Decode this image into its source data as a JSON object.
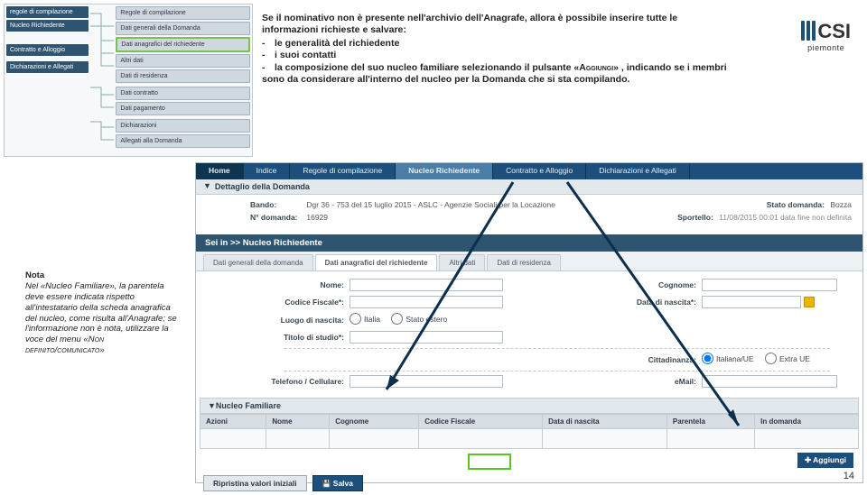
{
  "miniLeft": [
    "regole di compilazione",
    "Nucleo Richiedente",
    "",
    "",
    "Contratto e Alloggio",
    "",
    "Dichiarazioni e Allegati"
  ],
  "miniRight": [
    "Regole di compilazione",
    "Dati generali della Domanda",
    "Dati anagrafici del richiedente",
    "Altri dati",
    "Dati di residenza",
    "",
    "Dati contratto",
    "Dati pagamento",
    "",
    "Dichiarazioni",
    "Allegati alla Domanda"
  ],
  "intro": {
    "p1": "Se il nominativo non è presente nell'archivio dell'Anagrafe, allora è possibile inserire tutte le informazioni richieste e salvare:",
    "li1": "le generalità del richiedente",
    "li2": "i suoi contatti",
    "li3a": "la composizione del suo nucleo familiare selezionando il pulsante «",
    "li3btn": "Aggiungi",
    "li3b": "» , indicando se i membri sono da considerare all'interno del nucleo per la Domanda che si sta compilando."
  },
  "logo": {
    "brand": "CSI",
    "sub": "piemonte"
  },
  "note": {
    "title": "Nota",
    "body1": "Nel «Nucleo Familiare», la parentela deve essere indicata rispetto all'intestatario della scheda anagrafica del nucleo, come risulta all'Anagrafe; se l'informazione non è nota, utilizzare la voce del menu «",
    "sc": "Non definito/comunicato",
    "body2": "»"
  },
  "topbar": {
    "home": "Home",
    "t1": "Indice",
    "t2": "Regole di compilazione",
    "t3": "Nucleo Richiedente",
    "t4": "Contratto e Alloggio",
    "t5": "Dichiarazioni e Allegati"
  },
  "dettaglio": {
    "title": "Dettaglio della Domanda",
    "bandoL": "Bando:",
    "bandoV": "Dgr 36 - 753 del 15 luglio 2015 - ASLC - Agenzie Sociali per la Locazione",
    "numL": "N° domanda:",
    "numV": "16929",
    "statoL": "Stato domanda:",
    "statoV": "Bozza",
    "sportL": "Sportello:",
    "sportV": "11/08/2015 00:01   data fine non definita"
  },
  "crumb": "Sei in >> Nucleo Richiedente",
  "subtabs": {
    "t1": "Dati generali della domanda",
    "t2": "Dati anagrafici del richiedente",
    "t3": "Altri dati",
    "t4": "Dati di residenza"
  },
  "form": {
    "nome": "Nome:",
    "cognome": "Cognome:",
    "cf": "Codice Fiscale*:",
    "dn": "Data di nascita*:",
    "ln": "Luogo di nascita:",
    "r1": "Italia",
    "r2": "Stato estero",
    "ts": "Titolo di studio*:",
    "citt": "Cittadinanza:",
    "c1": "Italiana/UE",
    "c2": "Extra UE",
    "tel": "Telefono / Cellulare:",
    "mail": "eMail:"
  },
  "nf": {
    "title": "Nucleo Familiare",
    "h1": "Azioni",
    "h2": "Nome",
    "h3": "Cognome",
    "h4": "Codice Fiscale",
    "h5": "Data di nascita",
    "h6": "Parentela",
    "h7": "In domanda",
    "add": "Aggiungi"
  },
  "ftr": {
    "b1": "Ripristina valori iniziali",
    "b2": "Salva"
  },
  "page": "14"
}
